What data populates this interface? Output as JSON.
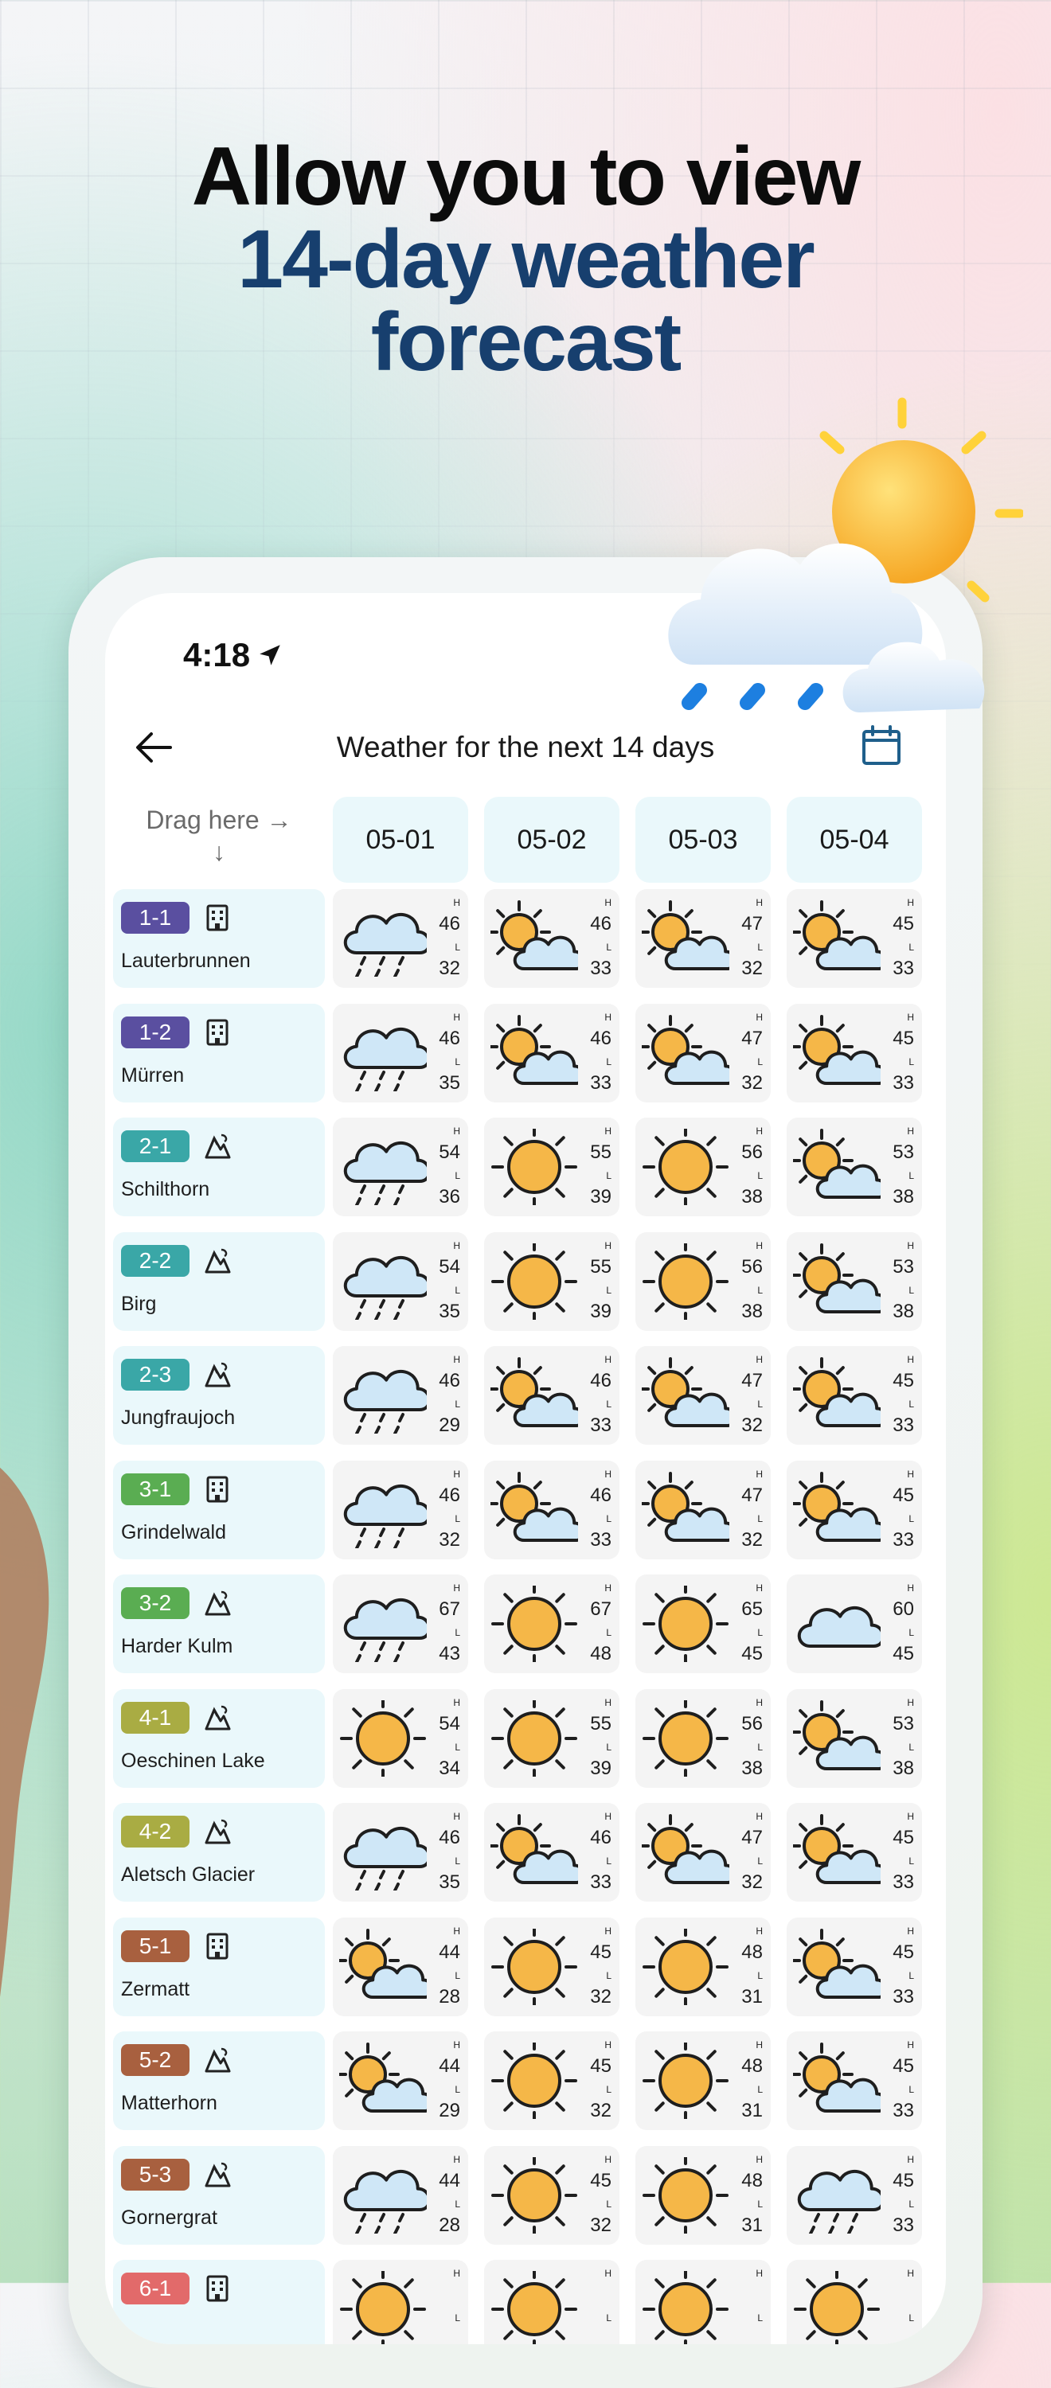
{
  "headline": {
    "line1": "Allow you to view",
    "line2": "14-day weather",
    "line3": "forecast"
  },
  "status": {
    "time": "4:18"
  },
  "nav": {
    "title": "Weather for the next 14 days",
    "back_icon": "arrow-left-icon",
    "calendar_icon": "calendar-icon"
  },
  "table": {
    "drag_label_line1": "Drag here →",
    "drag_label_line2": "↓",
    "dates": [
      "05-01",
      "05-02",
      "05-03",
      "05-04"
    ],
    "high_label": "H",
    "low_label": "L",
    "colors": {
      "purple": "#5a4fa0",
      "teal": "#3aa7a7",
      "green": "#5aad52",
      "olive": "#a9ac43",
      "brown": "#a8603f",
      "red": "#e26a6a"
    },
    "rows": [
      {
        "code": "1-1",
        "color": "#5a4fa0",
        "type": "building",
        "name": "Lauterbrunnen",
        "days": [
          {
            "icon": "rain",
            "h": "46",
            "l": "32"
          },
          {
            "icon": "partly",
            "h": "46",
            "l": "33"
          },
          {
            "icon": "partly",
            "h": "47",
            "l": "32"
          },
          {
            "icon": "partly",
            "h": "45",
            "l": "33"
          }
        ]
      },
      {
        "code": "1-2",
        "color": "#5a4fa0",
        "type": "building",
        "name": "Mürren",
        "days": [
          {
            "icon": "rain",
            "h": "46",
            "l": "35"
          },
          {
            "icon": "partly",
            "h": "46",
            "l": "33"
          },
          {
            "icon": "partly",
            "h": "47",
            "l": "32"
          },
          {
            "icon": "partly",
            "h": "45",
            "l": "33"
          }
        ]
      },
      {
        "code": "2-1",
        "color": "#3aa7a7",
        "type": "mountain",
        "name": "Schilthorn",
        "days": [
          {
            "icon": "rain",
            "h": "54",
            "l": "36"
          },
          {
            "icon": "sun",
            "h": "55",
            "l": "39"
          },
          {
            "icon": "sun",
            "h": "56",
            "l": "38"
          },
          {
            "icon": "partly",
            "h": "53",
            "l": "38"
          }
        ]
      },
      {
        "code": "2-2",
        "color": "#3aa7a7",
        "type": "mountain",
        "name": "Birg",
        "days": [
          {
            "icon": "rain",
            "h": "54",
            "l": "35"
          },
          {
            "icon": "sun",
            "h": "55",
            "l": "39"
          },
          {
            "icon": "sun",
            "h": "56",
            "l": "38"
          },
          {
            "icon": "partly",
            "h": "53",
            "l": "38"
          }
        ]
      },
      {
        "code": "2-3",
        "color": "#3aa7a7",
        "type": "mountain",
        "name": "Jungfraujoch",
        "days": [
          {
            "icon": "rain",
            "h": "46",
            "l": "29"
          },
          {
            "icon": "partly",
            "h": "46",
            "l": "33"
          },
          {
            "icon": "partly",
            "h": "47",
            "l": "32"
          },
          {
            "icon": "partly",
            "h": "45",
            "l": "33"
          }
        ]
      },
      {
        "code": "3-1",
        "color": "#5aad52",
        "type": "building",
        "name": "Grindelwald",
        "days": [
          {
            "icon": "rain",
            "h": "46",
            "l": "32"
          },
          {
            "icon": "partly",
            "h": "46",
            "l": "33"
          },
          {
            "icon": "partly",
            "h": "47",
            "l": "32"
          },
          {
            "icon": "partly",
            "h": "45",
            "l": "33"
          }
        ]
      },
      {
        "code": "3-2",
        "color": "#5aad52",
        "type": "mountain",
        "name": "Harder Kulm",
        "days": [
          {
            "icon": "rain",
            "h": "67",
            "l": "43"
          },
          {
            "icon": "sun",
            "h": "67",
            "l": "48"
          },
          {
            "icon": "sun",
            "h": "65",
            "l": "45"
          },
          {
            "icon": "cloud",
            "h": "60",
            "l": "45"
          }
        ]
      },
      {
        "code": "4-1",
        "color": "#a9ac43",
        "type": "mountain",
        "name": "Oeschinen Lake",
        "days": [
          {
            "icon": "sun",
            "h": "54",
            "l": "34"
          },
          {
            "icon": "sun",
            "h": "55",
            "l": "39"
          },
          {
            "icon": "sun",
            "h": "56",
            "l": "38"
          },
          {
            "icon": "partly",
            "h": "53",
            "l": "38"
          }
        ]
      },
      {
        "code": "4-2",
        "color": "#a9ac43",
        "type": "mountain",
        "name": "Aletsch Glacier",
        "days": [
          {
            "icon": "rain",
            "h": "46",
            "l": "35"
          },
          {
            "icon": "partly",
            "h": "46",
            "l": "33"
          },
          {
            "icon": "partly",
            "h": "47",
            "l": "32"
          },
          {
            "icon": "partly",
            "h": "45",
            "l": "33"
          }
        ]
      },
      {
        "code": "5-1",
        "color": "#a8603f",
        "type": "building",
        "name": "Zermatt",
        "days": [
          {
            "icon": "partly",
            "h": "44",
            "l": "28"
          },
          {
            "icon": "sun",
            "h": "45",
            "l": "32"
          },
          {
            "icon": "sun",
            "h": "48",
            "l": "31"
          },
          {
            "icon": "partly",
            "h": "45",
            "l": "33"
          }
        ]
      },
      {
        "code": "5-2",
        "color": "#a8603f",
        "type": "mountain",
        "name": "Matterhorn",
        "days": [
          {
            "icon": "partly",
            "h": "44",
            "l": "29"
          },
          {
            "icon": "sun",
            "h": "45",
            "l": "32"
          },
          {
            "icon": "sun",
            "h": "48",
            "l": "31"
          },
          {
            "icon": "partly",
            "h": "45",
            "l": "33"
          }
        ]
      },
      {
        "code": "5-3",
        "color": "#a8603f",
        "type": "mountain",
        "name": "Gornergrat",
        "days": [
          {
            "icon": "rain",
            "h": "44",
            "l": "28"
          },
          {
            "icon": "sun",
            "h": "45",
            "l": "32"
          },
          {
            "icon": "sun",
            "h": "48",
            "l": "31"
          },
          {
            "icon": "rain",
            "h": "45",
            "l": "33"
          }
        ]
      },
      {
        "code": "6-1",
        "color": "#e26a6a",
        "type": "building",
        "name": "",
        "days": [
          {
            "icon": "sun",
            "h": "",
            "l": ""
          },
          {
            "icon": "sun",
            "h": "",
            "l": ""
          },
          {
            "icon": "sun",
            "h": "",
            "l": ""
          },
          {
            "icon": "sun",
            "h": "",
            "l": ""
          }
        ]
      }
    ]
  }
}
